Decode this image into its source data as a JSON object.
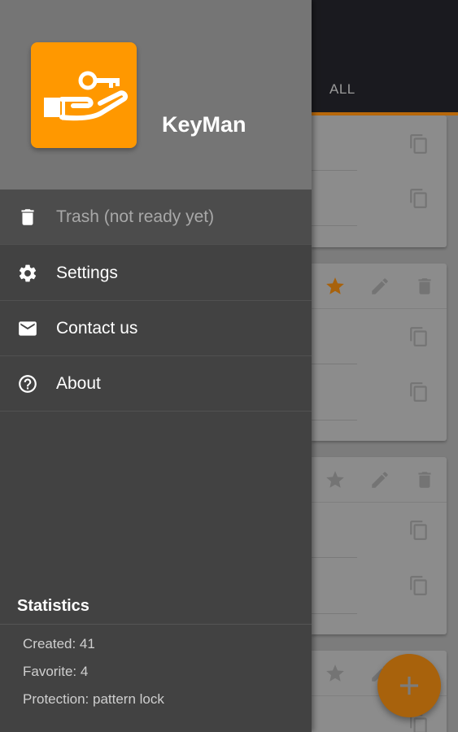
{
  "background": {
    "tab_label": "ALL",
    "fab_icon": "plus-icon",
    "accent_color": "#ff9800"
  },
  "drawer": {
    "app_name": "KeyMan",
    "logo_icon": "key-hand-icon",
    "menu": [
      {
        "label": "Trash (not ready yet)",
        "icon": "trash-icon",
        "enabled": false
      },
      {
        "label": "Settings",
        "icon": "gear-icon",
        "enabled": true
      },
      {
        "label": "Contact us",
        "icon": "mail-icon",
        "enabled": true
      },
      {
        "label": "About",
        "icon": "help-circle-icon",
        "enabled": true
      }
    ],
    "statistics": {
      "title": "Statistics",
      "created": "Created: 41",
      "favorite": "Favorite: 4",
      "protection": "Protection: pattern lock"
    }
  }
}
